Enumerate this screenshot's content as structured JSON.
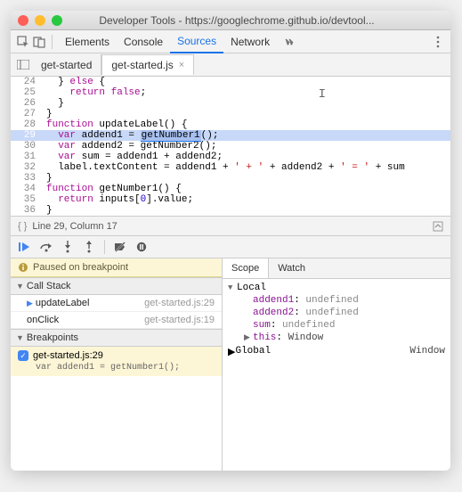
{
  "window": {
    "title": "Developer Tools - https://googlechrome.github.io/devtool..."
  },
  "mainTabs": [
    "Elements",
    "Console",
    "Sources",
    "Network"
  ],
  "mainTabActive": 2,
  "fileTabs": [
    {
      "label": "get-started",
      "active": false,
      "closable": false
    },
    {
      "label": "get-started.js",
      "active": true,
      "closable": true
    }
  ],
  "code": {
    "startLine": 24,
    "lines": [
      {
        "n": 24,
        "html": "  } <span class='kw'>else</span> {"
      },
      {
        "n": 25,
        "html": "    <span class='kw'>return</span> <span class='kw'>false</span>;"
      },
      {
        "n": 26,
        "html": "  }"
      },
      {
        "n": 27,
        "html": "}"
      },
      {
        "n": 28,
        "html": "<span class='kw'>function</span> updateLabel() {"
      },
      {
        "n": 29,
        "hl": true,
        "html": "  <span class='kw'>var</span> addend1 = <span class='funcbox'>getNumber1</span>();"
      },
      {
        "n": 30,
        "html": "  <span class='kw'>var</span> addend2 = getNumber2();"
      },
      {
        "n": 31,
        "html": "  <span class='kw'>var</span> sum = addend1 + addend2;"
      },
      {
        "n": 32,
        "html": "  label.textContent = addend1 + <span class='str'>' + '</span> + addend2 + <span class='str'>' = '</span> + sum"
      },
      {
        "n": 33,
        "html": "}"
      },
      {
        "n": 34,
        "html": "<span class='kw'>function</span> getNumber1() {"
      },
      {
        "n": 35,
        "html": "  <span class='kw'>return</span> inputs[<span class='num'>0</span>].value;"
      },
      {
        "n": 36,
        "html": "}"
      }
    ]
  },
  "status": {
    "text": "Line 29, Column 17"
  },
  "pauseMsg": "Paused on breakpoint",
  "sections": {
    "callStack": "Call Stack",
    "breakpoints": "Breakpoints"
  },
  "callStack": [
    {
      "fn": "updateLabel",
      "loc": "get-started.js:29"
    },
    {
      "fn": "onClick",
      "loc": "get-started.js:19"
    }
  ],
  "breakpoints": [
    {
      "label": "get-started.js:29",
      "preview": "var addend1 = getNumber1();",
      "checked": true
    }
  ],
  "scopeTabs": [
    "Scope",
    "Watch"
  ],
  "scopeTabActive": 0,
  "scope": {
    "localLabel": "Local",
    "vars": [
      {
        "name": "addend1",
        "value": "undefined"
      },
      {
        "name": "addend2",
        "value": "undefined"
      },
      {
        "name": "sum",
        "value": "undefined"
      }
    ],
    "thisLabel": "this",
    "thisValue": "Window",
    "globalLabel": "Global",
    "globalValue": "Window"
  }
}
